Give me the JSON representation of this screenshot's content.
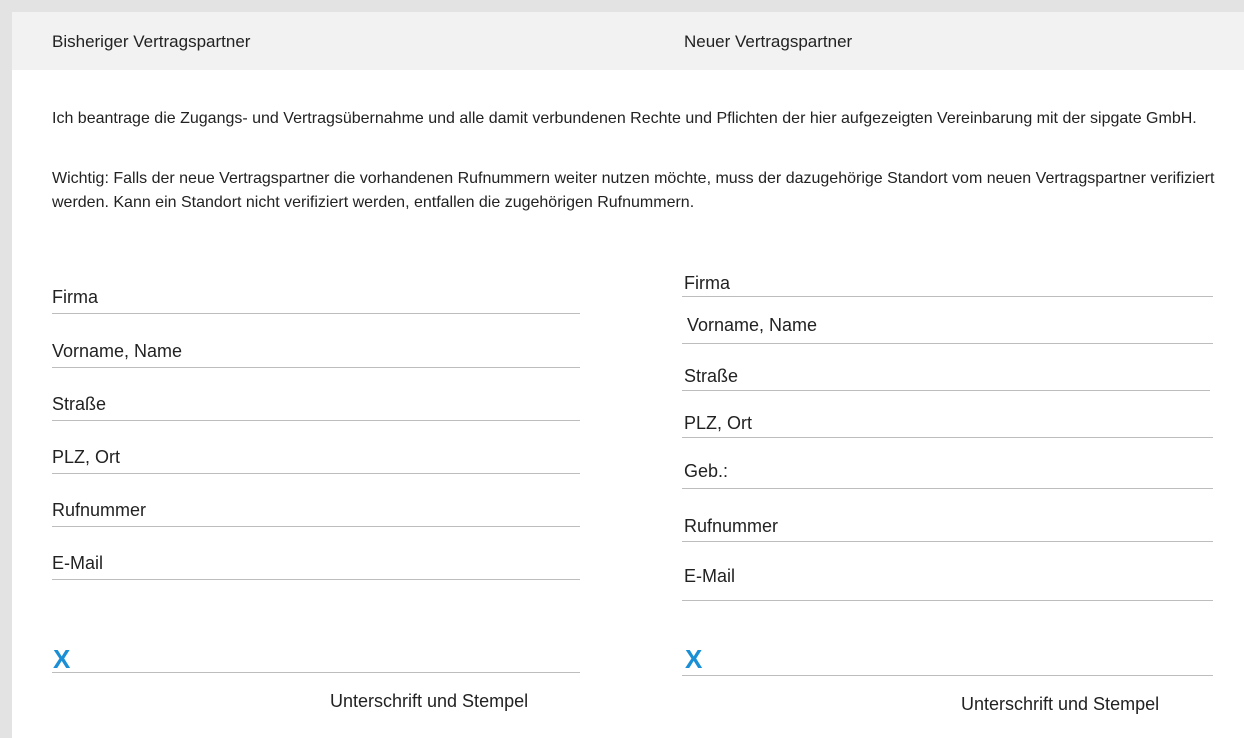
{
  "header": {
    "left_title": "Bisheriger Vertragspartner",
    "right_title": "Neuer Vertragspartner"
  },
  "intro": {
    "paragraph1": "Ich beantrage die Zugangs- und Vertragsübernahme und alle damit verbundenen Rechte und Pflichten der hier aufgezeigten Vereinbarung mit der sipgate GmbH.",
    "paragraph2": "Wichtig: Falls der neue Vertragspartner die vorhandenen Rufnummern weiter nutzen möchte, muss der dazugehörige Standort vom neuen Vertragspartner verifiziert werden. Kann ein Standort nicht verifiziert werden, entfallen die zugehörigen Rufnummern."
  },
  "left_form": {
    "fields": [
      "Firma",
      "Vorname, Name",
      "Straße",
      "PLZ, Ort",
      "Rufnummer",
      "E-Mail"
    ],
    "signature_mark": "X",
    "signature_caption": "Unterschrift und Stempel"
  },
  "right_form": {
    "fields": [
      "Firma",
      "Vorname, Name",
      "Straße",
      "PLZ, Ort",
      "Geb.:",
      "Rufnummer",
      "E-Mail"
    ],
    "signature_mark": "X",
    "signature_caption": "Unterschrift und Stempel"
  },
  "colors": {
    "accent": "#1a8fd6",
    "header_bg": "#f2f2f2",
    "frame": "#e3e3e3",
    "line": "#bdbdbd"
  }
}
